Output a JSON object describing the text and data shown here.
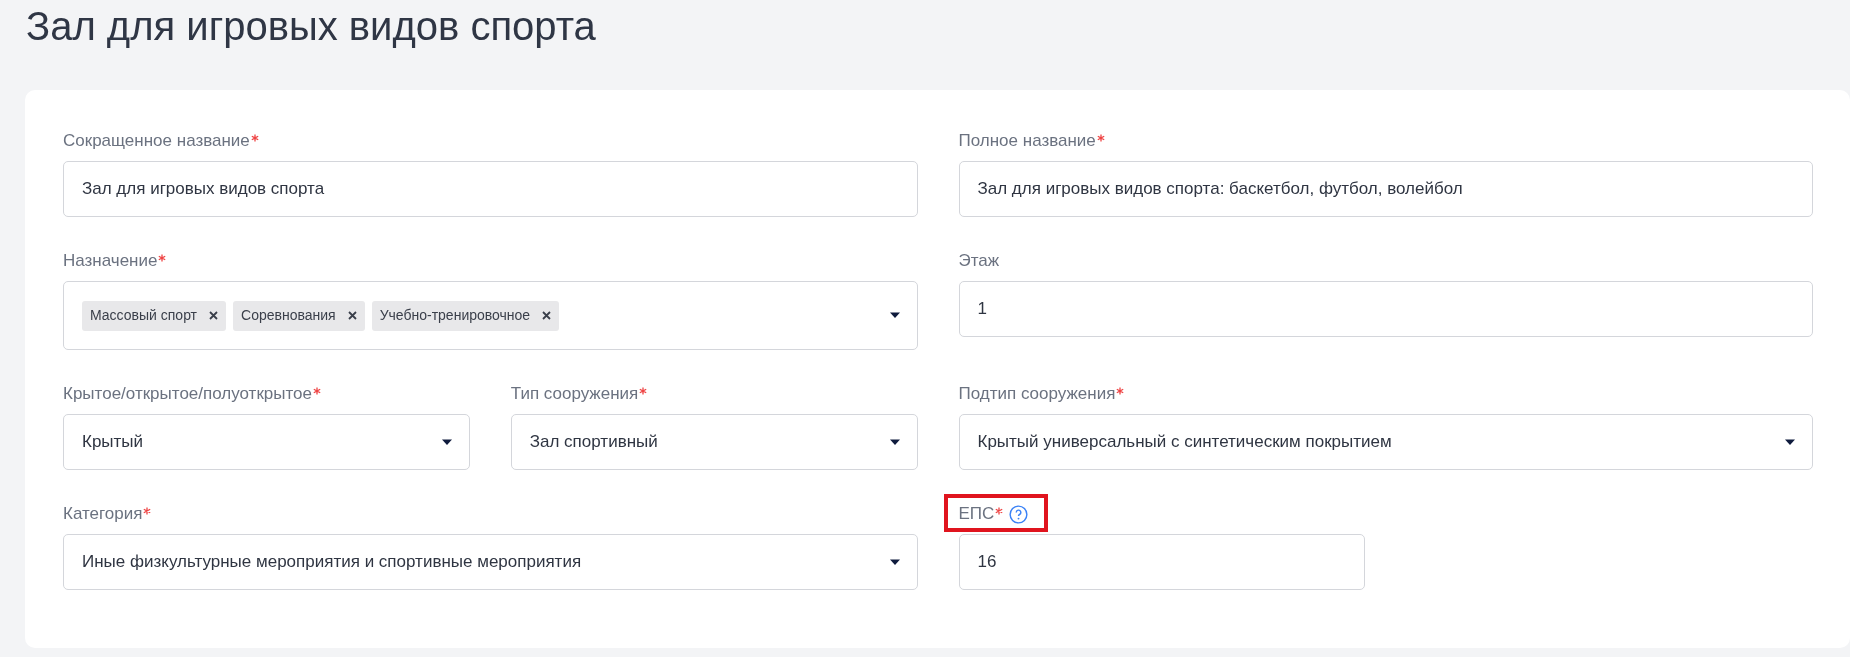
{
  "title": "Зал для игровых видов спорта",
  "rows": [
    [
      {
        "label": "Сокращенное название",
        "required": true,
        "kind": "text",
        "value": "Зал для игровых видов спорта"
      },
      {
        "label": "Полное название",
        "required": true,
        "kind": "text",
        "value": "Зал для игровых видов спорта: баскетбол, футбол, волейбол"
      }
    ],
    [
      {
        "label": "Назначение",
        "required": true,
        "kind": "multiselect",
        "tags": [
          "Массовый спорт",
          "Соревнования",
          "Учебно-тренировочное"
        ]
      },
      {
        "label": "Этаж",
        "required": false,
        "kind": "text",
        "value": "1"
      }
    ],
    [
      {
        "label": "Крытое/открытое/полуоткрытое",
        "required": true,
        "kind": "select",
        "value": "Крытый"
      },
      {
        "label": "Тип сооружения",
        "required": true,
        "kind": "select",
        "value": "Зал спортивный"
      },
      {
        "label": "Подтип сооружения",
        "required": true,
        "kind": "select",
        "value": "Крытый универсальный с синтетическим покрытием"
      }
    ],
    [
      {
        "label": "Категория",
        "required": true,
        "kind": "select",
        "value": "Иные физкультурные мероприятия и спортивные мероприятия"
      },
      {
        "label": "ЕПС",
        "required": true,
        "kind": "short_text",
        "value": "16",
        "help": true,
        "highlighted": true
      }
    ]
  ]
}
